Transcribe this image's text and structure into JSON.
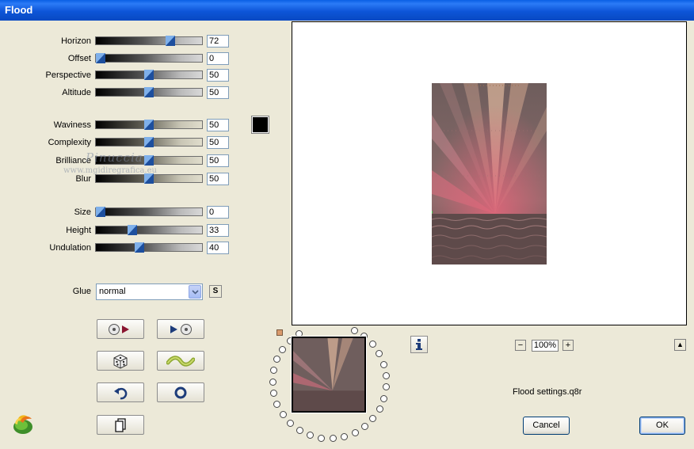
{
  "window": {
    "title": "Flood"
  },
  "sliders": [
    {
      "label": "Horizon",
      "value": "72",
      "level": 72
    },
    {
      "label": "Offset",
      "value": "0",
      "level": 0
    },
    {
      "label": "Perspective",
      "value": "50",
      "level": 50
    },
    {
      "label": "Altitude",
      "value": "50",
      "level": 50
    },
    {
      "label": "Waviness",
      "value": "50",
      "level": 50
    },
    {
      "label": "Complexity",
      "value": "50",
      "level": 50
    },
    {
      "label": "Brilliance",
      "value": "50",
      "level": 50
    },
    {
      "label": "Blur",
      "value": "50",
      "level": 50
    },
    {
      "label": "Size",
      "value": "0",
      "level": 0
    },
    {
      "label": "Height",
      "value": "33",
      "level": 33
    },
    {
      "label": "Undulation",
      "value": "40",
      "level": 40
    }
  ],
  "color_swatch": {
    "color": "#000000"
  },
  "glue": {
    "label": "Glue",
    "selected": "normal",
    "s_button": "S"
  },
  "tool_buttons": [
    {
      "icon": "load-preset-icon"
    },
    {
      "icon": "save-preset-icon"
    },
    {
      "icon": "dice-randomize-icon"
    },
    {
      "icon": "wave-icon"
    },
    {
      "icon": "undo-icon"
    },
    {
      "icon": "reset-circle-icon"
    },
    {
      "icon": "copy-page-icon"
    }
  ],
  "watermark": {
    "line1": "Pinuccia",
    "line2": "www.mgidiregrafica.eu"
  },
  "zoom": {
    "minus": "−",
    "value": "100%",
    "plus": "+"
  },
  "scroll": {
    "up": "▲"
  },
  "settings_file": "Flood settings.q8r",
  "buttons": {
    "cancel": "Cancel",
    "ok": "OK"
  },
  "colors": {
    "titlebar": "#0a5fe5",
    "dialog_bg": "#ece9d8",
    "ok_border": "#003c74"
  }
}
